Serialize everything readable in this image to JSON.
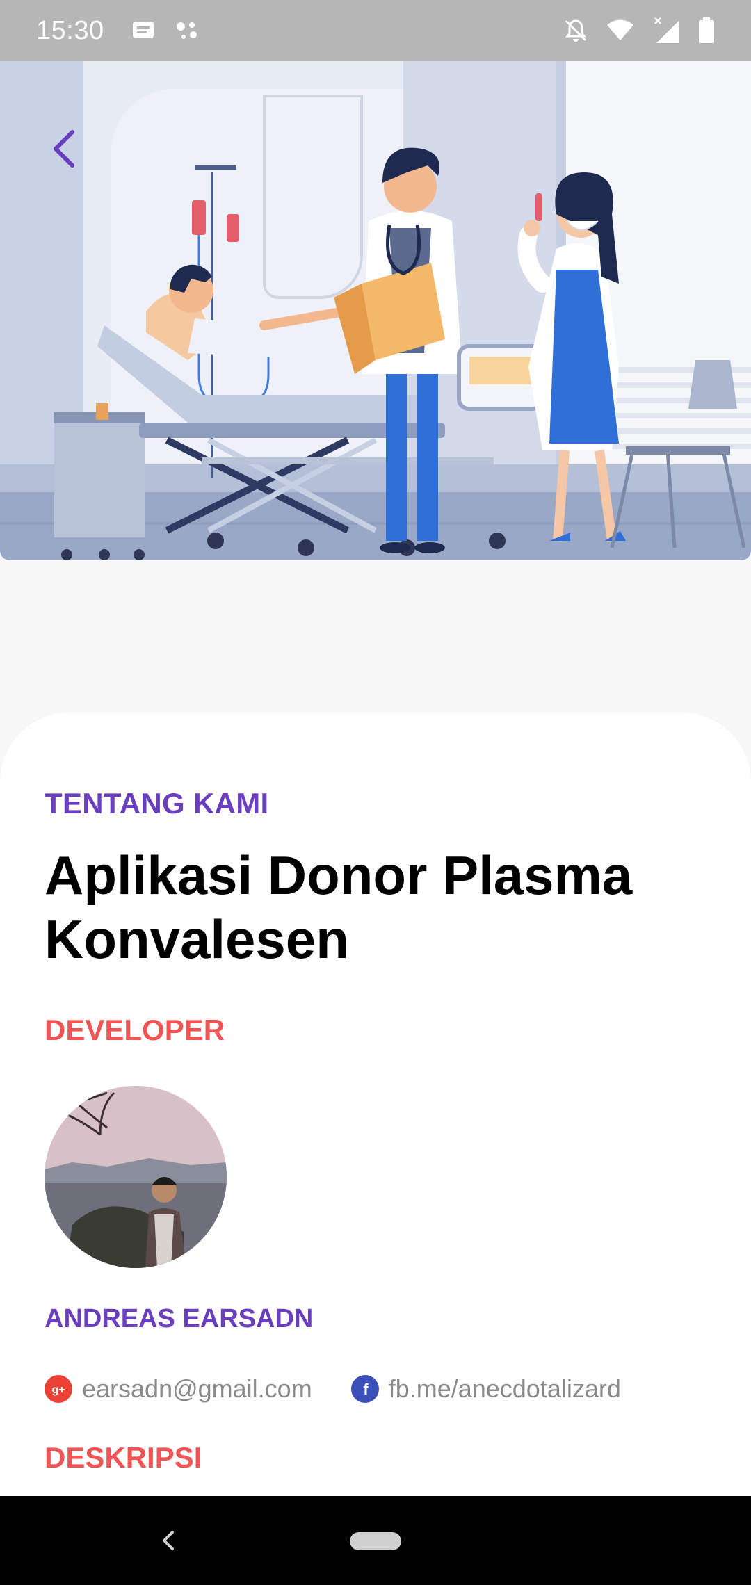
{
  "status_bar": {
    "time": "15:30",
    "left_icons": [
      "message-icon",
      "assistant-dots-icon"
    ],
    "right_icons": [
      "notifications-off-icon",
      "wifi-icon",
      "signal-icon",
      "battery-icon"
    ]
  },
  "hero": {
    "illustration": "hospital-illustration",
    "back_icon": "chevron-left-icon"
  },
  "about": {
    "eyebrow": "TENTANG KAMI",
    "title": "Aplikasi Donor Plasma Konvalesen"
  },
  "developer": {
    "label": "DEVELOPER",
    "name": "ANDREAS EARSADN",
    "email": "earsadn@gmail.com",
    "facebook": "fb.me/anecdotalizard"
  },
  "description": {
    "label": "DESKRIPSI"
  },
  "colors": {
    "primary_purple": "#6a3fbf",
    "accent_red": "#f15454",
    "google_red": "#ea4335",
    "facebook_blue": "#3b4fb8"
  }
}
